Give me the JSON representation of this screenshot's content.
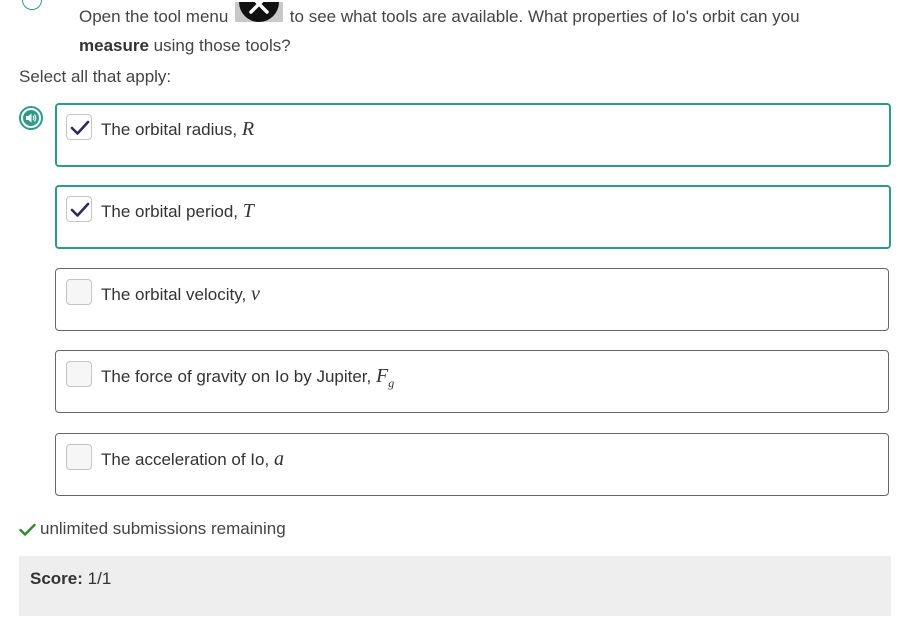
{
  "question": {
    "part1": "Open the tool menu",
    "part2": "to see what tools are available. What properties of Io's orbit can you",
    "bold_word": "measure",
    "part3": "using those tools?"
  },
  "instructions": "Select all that apply:",
  "options": [
    {
      "text": "The orbital radius,",
      "variable": "R",
      "subscript": "",
      "checked": true
    },
    {
      "text": "The orbital period,",
      "variable": "T",
      "subscript": "",
      "checked": true
    },
    {
      "text": "The orbital velocity,",
      "variable": "v",
      "subscript": "",
      "checked": false
    },
    {
      "text": "The force of gravity on Io by Jupiter,",
      "variable": "F",
      "subscript": "g",
      "checked": false
    },
    {
      "text": "The acceleration of Io,",
      "variable": "a",
      "subscript": "",
      "checked": false
    }
  ],
  "submissions_text": "unlimited submissions remaining",
  "score": {
    "label": "Score:",
    "value": "1/1"
  },
  "icons": {
    "tool_menu": "close-x-icon",
    "speaker": "speaker-icon",
    "check": "check-icon"
  },
  "colors": {
    "accent": "#2e9a8a",
    "checkmark": "#2c2c5a",
    "success_check": "#2e8b2e",
    "score_bg": "#eeeeee"
  }
}
